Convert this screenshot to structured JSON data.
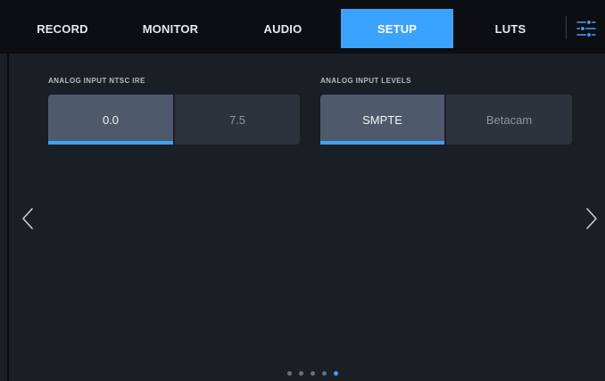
{
  "tabs": [
    {
      "label": "RECORD",
      "active": false
    },
    {
      "label": "MONITOR",
      "active": false
    },
    {
      "label": "AUDIO",
      "active": false
    },
    {
      "label": "SETUP",
      "active": true
    },
    {
      "label": "LUTS",
      "active": false
    }
  ],
  "icons": {
    "settings": "sliders-icon",
    "prev": "chevron-left-icon",
    "next": "chevron-right-icon"
  },
  "colors": {
    "accent": "#3aa3ff",
    "background": "#1a1e25",
    "tabbar": "#0c0e11",
    "segment_selected": "#4e5a6b",
    "segment_unselected": "#2d333c"
  },
  "setup": {
    "analog_ntsc_ire": {
      "label": "ANALOG INPUT NTSC IRE",
      "options": [
        "0.0",
        "7.5"
      ],
      "selected": "0.0"
    },
    "analog_input_levels": {
      "label": "ANALOG INPUT LEVELS",
      "options": [
        "SMPTE",
        "Betacam"
      ],
      "selected": "SMPTE"
    }
  },
  "pagination": {
    "total_pages": 5,
    "current_page": 5
  }
}
